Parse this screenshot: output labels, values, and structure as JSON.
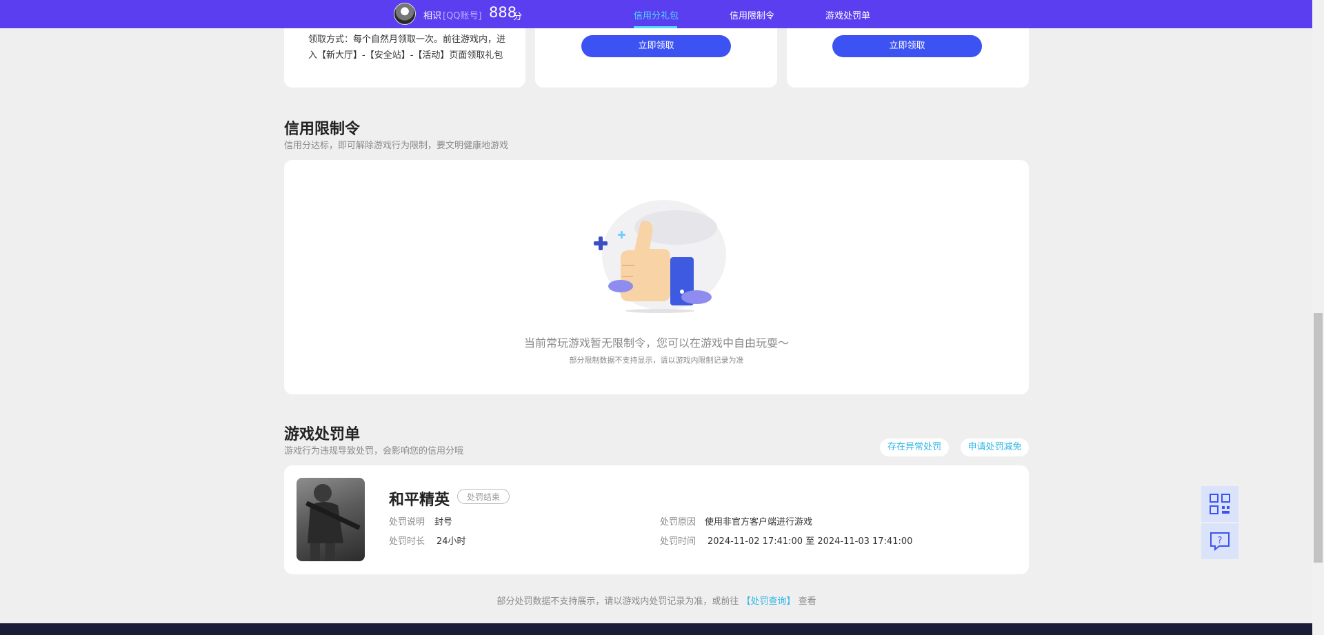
{
  "header": {
    "username": "相识",
    "account_type": "[QQ账号]",
    "score": "888",
    "score_unit": "分",
    "tabs": [
      {
        "label": "信用分礼包",
        "active": true
      },
      {
        "label": "信用限制令",
        "active": false
      },
      {
        "label": "游戏处罚单",
        "active": false
      }
    ]
  },
  "gift_cards": {
    "claim_method": "领取方式：每个自然月领取一次。前往游戏内，进入【新大厅】-【安全站】-【活动】页面领取礼包",
    "claim_button_1": "立即领取",
    "claim_button_2": "立即领取"
  },
  "restriction": {
    "title": "信用限制令",
    "subtitle": "信用分达标，即可解除游戏行为限制，要文明健康地游戏",
    "empty_message": "当前常玩游戏暂无限制令，您可以在游戏中自由玩耍～",
    "empty_note": "部分限制数据不支持显示，请以游戏内限制记录为准"
  },
  "penalty": {
    "title": "游戏处罚单",
    "subtitle": "游戏行为违规导致处罚，会影响您的信用分哦",
    "abnormal_button": "存在异常处罚",
    "appeal_button": "申请处罚减免",
    "record": {
      "game": "和平精英",
      "status": "处罚结束",
      "desc_label": "处罚说明",
      "desc_value": "封号",
      "duration_label": "处罚时长",
      "duration_value": "24小时",
      "reason_label": "处罚原因",
      "reason_value": "使用非官方客户端进行游戏",
      "time_label": "处罚时间",
      "time_value": "2024-11-02 17:41:00 至 2024-11-03 17:41:00"
    },
    "footnote_before": "部分处罚数据不支持展示，请以游戏内处罚记录为准，或前往",
    "footnote_link": "【处罚查询】",
    "footnote_after": "查看"
  },
  "colors": {
    "topbar": "#5b3ef0",
    "accent": "#3d52f2",
    "active_tab": "#4fdcff",
    "link": "#2fb6e8"
  },
  "icons": {
    "qr": "qr-code-icon",
    "help": "help-chat-icon",
    "empty_state": "thumbs-up-illustration"
  }
}
